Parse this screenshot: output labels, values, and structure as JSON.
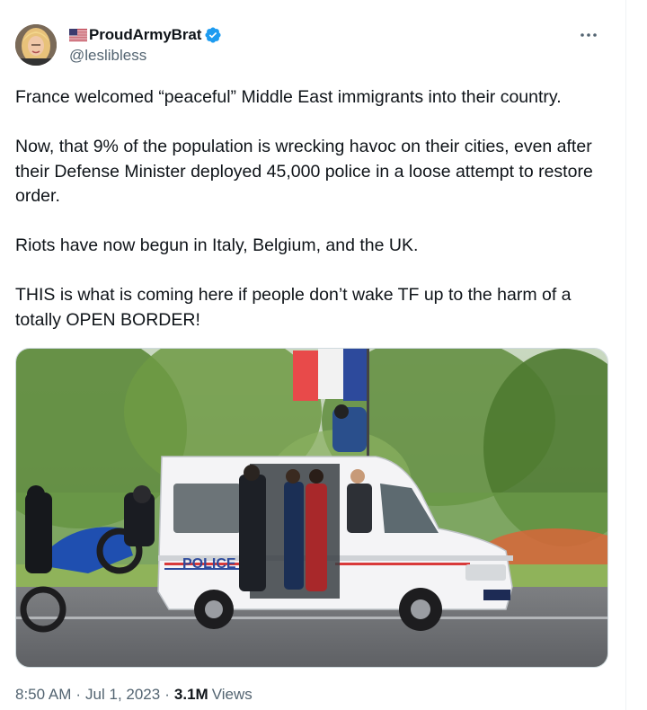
{
  "user": {
    "display_name": "ProudArmyBrat",
    "handle": "@leslibless",
    "flag_icon": "us-flag-icon",
    "verified_icon": "verified-badge-icon",
    "verified_color": "#1d9bf0"
  },
  "more_icon": "more-horizontal-icon",
  "tweet": {
    "paragraphs": [
      "France welcomed “peaceful” Middle East immigrants into their country.",
      "Now, that 9% of the population is wrecking havoc on their cities, even after their Defense Minister deployed 45,000 police in a loose attempt to restore order.",
      "Riots have now begun in Italy, Belgium, and the UK.",
      "THIS is what is coming here if people don’t wake TF up to the harm of a totally OPEN BORDER!"
    ]
  },
  "media": {
    "van_label": "POLICE"
  },
  "meta": {
    "time": "8:50 AM",
    "date": "Jul 1, 2023",
    "views_count": "3.1M",
    "views_label": "Views",
    "separator": "·"
  },
  "colors": {
    "text_primary": "#0f1419",
    "text_secondary": "#536471",
    "border": "#cfd9de"
  }
}
